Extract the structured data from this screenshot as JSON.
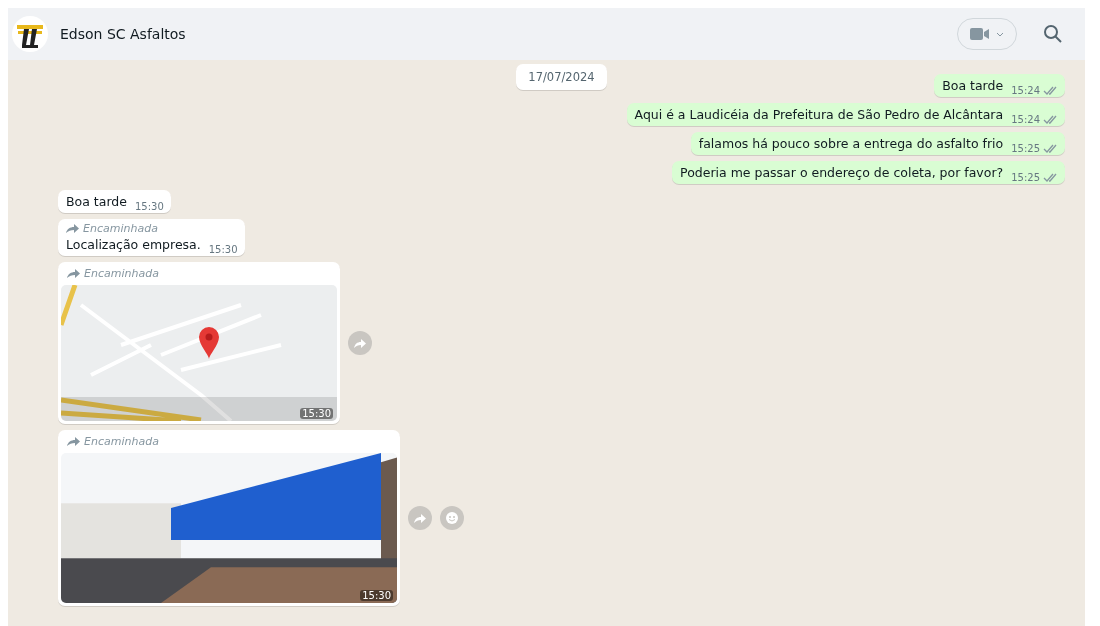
{
  "header": {
    "contact_name": "Edson SC Asfaltos"
  },
  "date_chip": "17/07/2024",
  "messages": [
    {
      "kind": "text",
      "outgoing": true,
      "text": "Boa tarde",
      "time": "15:24",
      "read": false
    },
    {
      "kind": "text",
      "outgoing": true,
      "text": "Aqui é a Laudicéia da Prefeitura de São Pedro de Alcântara",
      "time": "15:24",
      "read": false
    },
    {
      "kind": "text",
      "outgoing": true,
      "text": "falamos há pouco sobre a entrega do asfalto frio",
      "time": "15:25",
      "read": false
    },
    {
      "kind": "text",
      "outgoing": true,
      "text": "Poderia me passar o endereço de coleta, por favor?",
      "time": "15:25",
      "read": false
    },
    {
      "kind": "text",
      "outgoing": false,
      "text": "Boa tarde",
      "time": "15:30"
    },
    {
      "kind": "text",
      "outgoing": false,
      "forward_label": "Encaminhada",
      "text": "Localização empresa.",
      "time": "15:30"
    },
    {
      "kind": "location",
      "outgoing": false,
      "forward_label": "Encaminhada",
      "time": "15:30"
    },
    {
      "kind": "image",
      "outgoing": false,
      "forward_label": "Encaminhada",
      "time": "15:30"
    }
  ]
}
